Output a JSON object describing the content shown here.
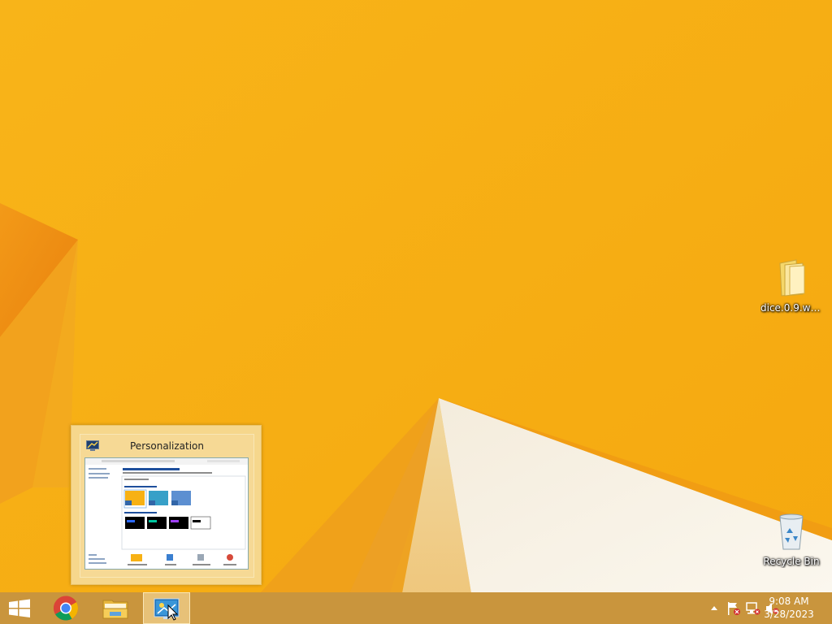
{
  "desktop": {
    "icons": [
      {
        "label": "dice.0.9.wi...",
        "icon": "folder-icon"
      },
      {
        "label": "Recycle Bin",
        "icon": "recycle-bin-icon"
      }
    ]
  },
  "thumbnail_preview": {
    "title": "Personalization",
    "icon": "personalization-icon"
  },
  "taskbar": {
    "items": [
      {
        "name": "Start",
        "icon": "windows-logo-icon"
      },
      {
        "name": "Google Chrome",
        "icon": "chrome-icon"
      },
      {
        "name": "File Explorer",
        "icon": "folder-explorer-icon"
      },
      {
        "name": "Personalization",
        "icon": "personalization-icon",
        "active": true
      }
    ],
    "tray": {
      "icons": [
        "show-hidden-icons-chevron",
        "action-center-flag-icon",
        "network-icon",
        "volume-muted-icon"
      ],
      "time": "9:08 AM",
      "date": "3/28/2023"
    }
  },
  "colors": {
    "wallpaper_primary": "#f7b114",
    "wallpaper_orange": "#ee8a12",
    "taskbar": "#c9953d",
    "preview_bg": "#f6d78c"
  }
}
